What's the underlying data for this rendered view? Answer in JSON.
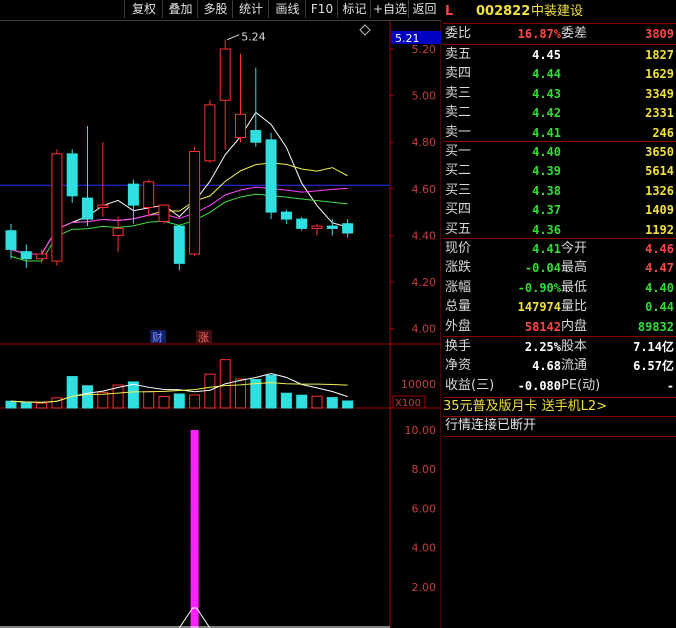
{
  "toolbar": {
    "buttons": [
      "复权",
      "叠加",
      "多股",
      "统计",
      "画线",
      "F10",
      "标记",
      "+自选",
      "返回"
    ]
  },
  "chart": {
    "corner_icon": "diamond-icon",
    "price_axis": [
      "5.20",
      "5.00",
      "4.80",
      "4.60",
      "4.40",
      "4.20",
      "4.00"
    ],
    "current_price_tag": "5.21",
    "high_annotation": "5.24",
    "markers": [
      "财",
      "涨"
    ],
    "volume_axis": [
      "10000"
    ],
    "volume_unit": "X100",
    "indicator_axis": [
      "10.00",
      "8.00",
      "6.00",
      "4.00",
      "2.00"
    ],
    "candles": [
      {
        "o": 4.42,
        "h": 4.45,
        "l": 4.3,
        "c": 4.34
      },
      {
        "o": 4.33,
        "h": 4.36,
        "l": 4.26,
        "c": 4.3
      },
      {
        "o": 4.3,
        "h": 4.34,
        "l": 4.28,
        "c": 4.32
      },
      {
        "o": 4.29,
        "h": 4.77,
        "l": 4.27,
        "c": 4.75
      },
      {
        "o": 4.75,
        "h": 4.77,
        "l": 4.54,
        "c": 4.57
      },
      {
        "o": 4.56,
        "h": 4.87,
        "l": 4.44,
        "c": 4.47
      },
      {
        "o": 4.52,
        "h": 4.8,
        "l": 4.48,
        "c": 4.53
      },
      {
        "o": 4.4,
        "h": 4.48,
        "l": 4.33,
        "c": 4.43
      },
      {
        "o": 4.62,
        "h": 4.64,
        "l": 4.45,
        "c": 4.53
      },
      {
        "o": 4.52,
        "h": 4.64,
        "l": 4.48,
        "c": 4.63
      },
      {
        "o": 4.46,
        "h": 4.53,
        "l": 4.45,
        "c": 4.53
      },
      {
        "o": 4.44,
        "h": 4.44,
        "l": 4.25,
        "c": 4.28
      },
      {
        "o": 4.32,
        "h": 4.78,
        "l": 4.31,
        "c": 4.76
      },
      {
        "o": 4.72,
        "h": 4.98,
        "l": 4.71,
        "c": 4.96
      },
      {
        "o": 4.98,
        "h": 5.24,
        "l": 4.77,
        "c": 5.2
      },
      {
        "o": 4.82,
        "h": 5.18,
        "l": 4.8,
        "c": 4.92
      },
      {
        "o": 4.85,
        "h": 5.12,
        "l": 4.78,
        "c": 4.8
      },
      {
        "o": 4.81,
        "h": 4.84,
        "l": 4.47,
        "c": 4.5
      },
      {
        "o": 4.5,
        "h": 4.51,
        "l": 4.45,
        "c": 4.47
      },
      {
        "o": 4.47,
        "h": 4.48,
        "l": 4.42,
        "c": 4.43
      },
      {
        "o": 4.43,
        "h": 4.45,
        "l": 4.4,
        "c": 4.44
      },
      {
        "o": 4.44,
        "h": 4.47,
        "l": 4.4,
        "c": 4.43
      },
      {
        "o": 4.45,
        "h": 4.47,
        "l": 4.39,
        "c": 4.41
      }
    ],
    "volumes": [
      2800,
      2200,
      2000,
      4200,
      13000,
      9200,
      6500,
      9500,
      10800,
      6800,
      4800,
      5800,
      5400,
      14000,
      20000,
      12000,
      11800,
      13500,
      6100,
      5300,
      4900,
      4300,
      2900
    ],
    "indicator_value": 10.0
  },
  "quote": {
    "tag": "L",
    "code": "002822",
    "name": "中装建设",
    "weibi": {
      "label": "委比",
      "value": "16.87%",
      "label2": "委差",
      "value2": "3809"
    },
    "sells": [
      {
        "label": "卖五",
        "price": "4.45",
        "vol": "1827"
      },
      {
        "label": "卖四",
        "price": "4.44",
        "vol": "1629"
      },
      {
        "label": "卖三",
        "price": "4.43",
        "vol": "3349"
      },
      {
        "label": "卖二",
        "price": "4.42",
        "vol": "2331"
      },
      {
        "label": "卖一",
        "price": "4.41",
        "vol": "246"
      }
    ],
    "buys": [
      {
        "label": "买一",
        "price": "4.40",
        "vol": "3650"
      },
      {
        "label": "买二",
        "price": "4.39",
        "vol": "5614"
      },
      {
        "label": "买三",
        "price": "4.38",
        "vol": "1326"
      },
      {
        "label": "买四",
        "price": "4.37",
        "vol": "1409"
      },
      {
        "label": "买五",
        "price": "4.36",
        "vol": "1192"
      }
    ],
    "stats1": [
      {
        "l": "现价",
        "v": "4.41",
        "vc": "green",
        "l2": "今开",
        "v2": "4.46",
        "v2c": "red"
      },
      {
        "l": "涨跌",
        "v": "-0.04",
        "vc": "green",
        "l2": "最高",
        "v2": "4.47",
        "v2c": "red"
      },
      {
        "l": "涨幅",
        "v": "-0.90%",
        "vc": "green",
        "l2": "最低",
        "v2": "4.40",
        "v2c": "green"
      },
      {
        "l": "总量",
        "v": "147974",
        "vc": "yellow",
        "l2": "量比",
        "v2": "0.44",
        "v2c": "green"
      },
      {
        "l": "外盘",
        "v": "58142",
        "vc": "red",
        "l2": "内盘",
        "v2": "89832",
        "v2c": "green"
      }
    ],
    "stats2": [
      {
        "l": "换手",
        "v": "2.25%",
        "vc": "white",
        "l2": "股本",
        "v2": "7.14亿",
        "v2c": "white"
      },
      {
        "l": "净资",
        "v": "4.68",
        "vc": "white",
        "l2": "流通",
        "v2": "6.57亿",
        "v2c": "white"
      },
      {
        "l": "收益(三)",
        "v": "-0.080",
        "vc": "white",
        "l2": "PE(动)",
        "v2": "-",
        "v2c": "white"
      }
    ],
    "promo": "35元普及版月卡 送手机L2>",
    "status": "行情连接已断开"
  }
}
